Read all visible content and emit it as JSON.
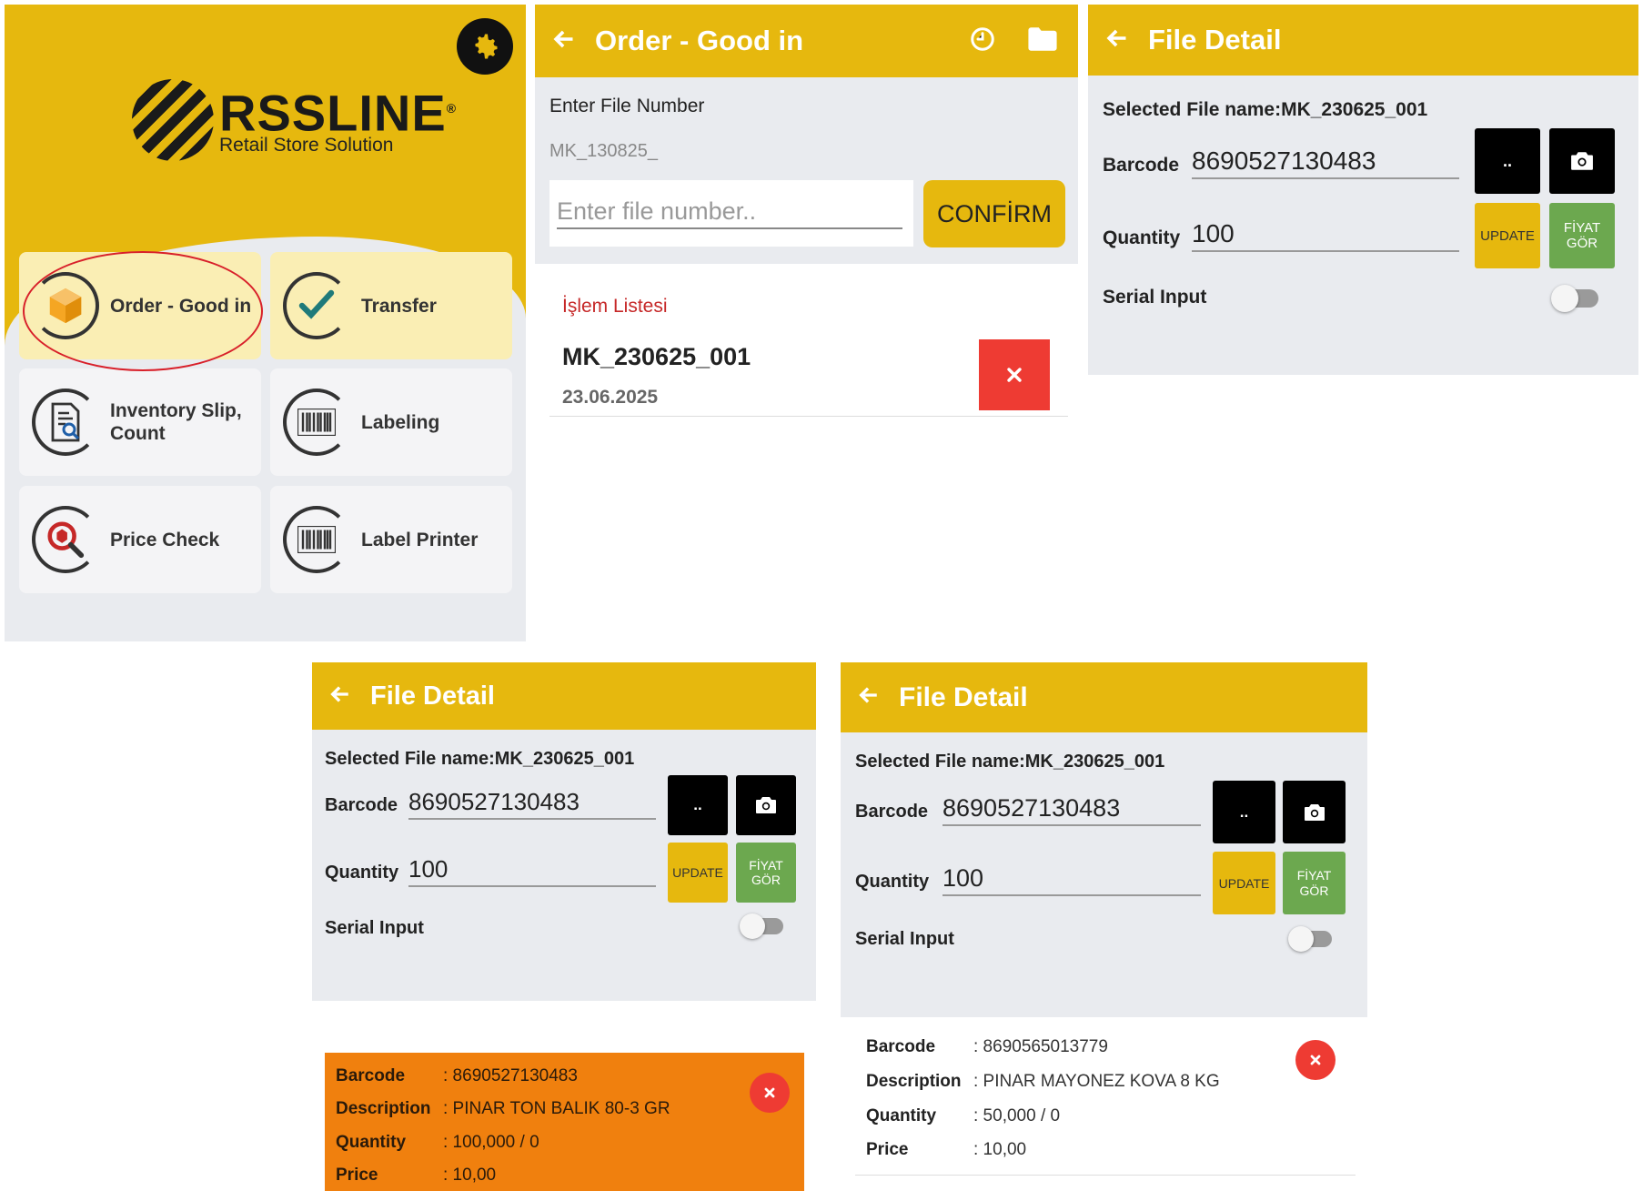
{
  "home": {
    "brand": "RSSLINE",
    "brand_mark": "®",
    "tagline": "Retail Store Solution",
    "tiles": [
      {
        "label": "Order - Good in",
        "icon": "box-icon"
      },
      {
        "label": "Transfer",
        "icon": "checkmark-icon"
      },
      {
        "label": "Inventory Slip, Count",
        "icon": "document-search-icon"
      },
      {
        "label": "Labeling",
        "icon": "barcode-icon"
      },
      {
        "label": "Price Check",
        "icon": "magnifier-icon"
      },
      {
        "label": "Label Printer",
        "icon": "barcode-icon"
      }
    ]
  },
  "order": {
    "title": "Order - Good in",
    "enter_label": "Enter File Number",
    "prefix": "MK_130825_",
    "input_placeholder": "Enter file number..",
    "confirm_label": "CONFİRM",
    "list_title": "İşlem Listesi",
    "items": [
      {
        "code": "MK_230625_001",
        "date": "23.06.2025"
      }
    ]
  },
  "file_detail": {
    "title": "File Detail",
    "selected_file": "Selected File name:MK_230625_001",
    "barcode_label": "Barcode",
    "barcode_value": "8690527130483",
    "quantity_label": "Quantity",
    "quantity_value": "100",
    "dots_label": "..",
    "update_label": "UPDATE",
    "fiyat_line1": "FİYAT",
    "fiyat_line2": "GÖR",
    "serial_label": "Serial Input"
  },
  "cards": [
    {
      "barcode_key": "Barcode",
      "barcode": ": 8690527130483",
      "desc_key": "Description",
      "desc": ": PINAR TON BALIK 80-3 GR",
      "qty_key": "Quantity",
      "qty": ": 100,000 / 0",
      "price_key": "Price",
      "price": ": 10,00"
    },
    {
      "barcode_key": "Barcode",
      "barcode": ": 8690565013779",
      "desc_key": "Description",
      "desc": ": PINAR MAYONEZ KOVA 8 KG",
      "qty_key": "Quantity",
      "qty": ": 50,000 / 0",
      "price_key": "Price",
      "price": ": 10,00"
    }
  ],
  "colors": {
    "accent": "#e6b80e",
    "danger": "#ee3b33",
    "highlight_card": "#f0800e",
    "green": "#6ca84f"
  }
}
